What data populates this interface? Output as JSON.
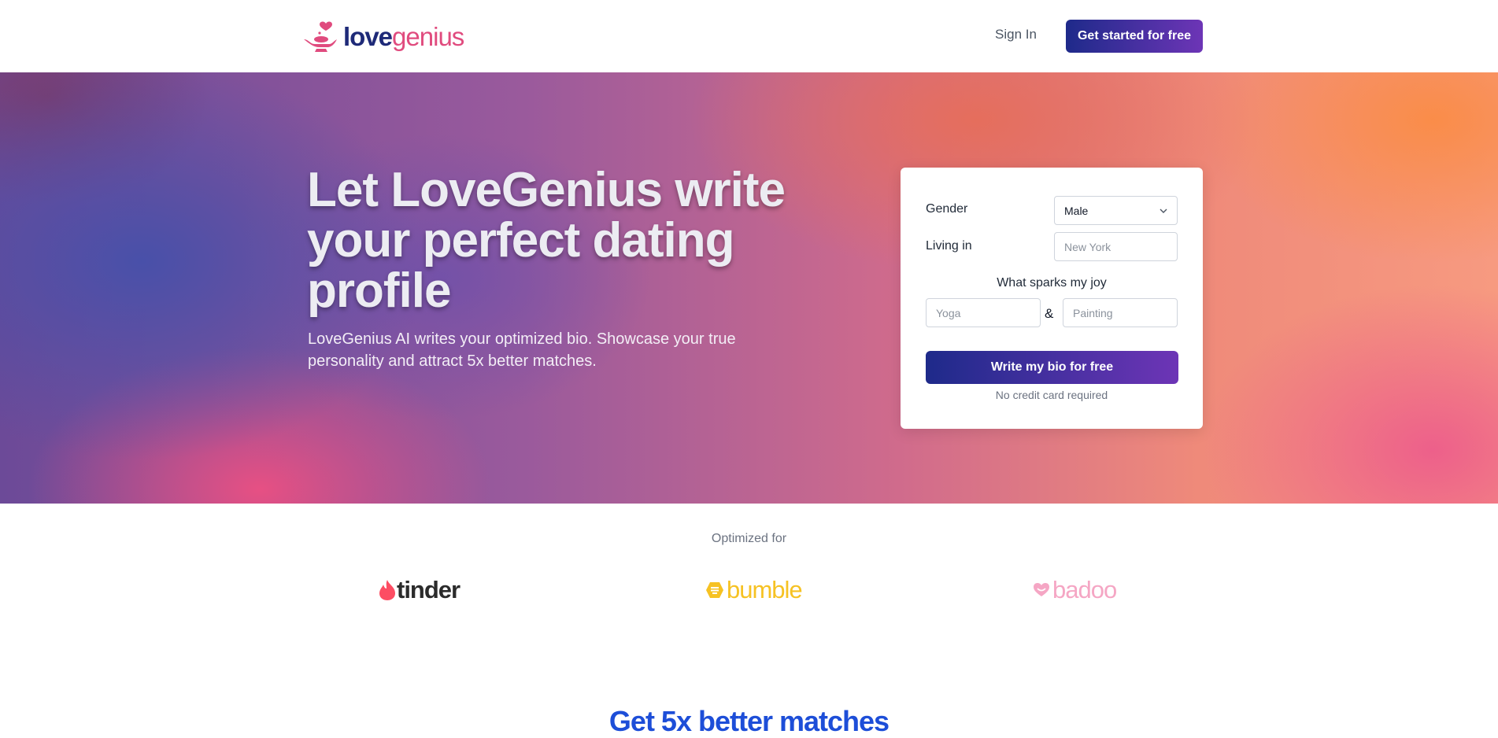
{
  "header": {
    "logo_love": "love",
    "logo_genius": "genius",
    "signin_label": "Sign In",
    "cta_label": "Get started for free"
  },
  "hero": {
    "title": "Let LoveGenius write your perfect dating profile",
    "subtitle": "LoveGenius AI writes your optimized bio. Showcase your true personality and attract 5x better matches."
  },
  "form": {
    "gender_label": "Gender",
    "gender_value": "Male",
    "living_label": "Living in",
    "living_placeholder": "New York",
    "joy_label": "What sparks my joy",
    "joy1_placeholder": "Yoga",
    "amp": "&",
    "joy2_placeholder": "Painting",
    "submit_label": "Write my bio for free",
    "note": "No credit card required"
  },
  "brands": {
    "label": "Optimized for",
    "tinder": "tinder",
    "bumble": "bumble",
    "badoo": "badoo"
  },
  "section": {
    "title": "Get 5x better matches"
  },
  "colors": {
    "brand_navy": "#1e2a78",
    "brand_pink": "#e04b7e",
    "button_gradient_start": "#1e2a8a",
    "button_gradient_end": "#6d35b6",
    "section_title_blue": "#1d4ed8"
  }
}
